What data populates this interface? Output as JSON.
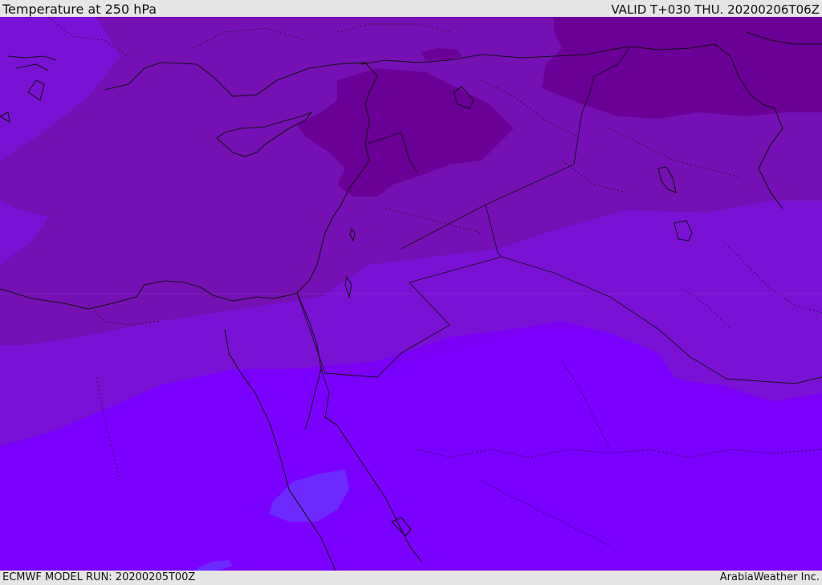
{
  "header": {
    "title": "Temperature at 250 hPa",
    "valid": "VALID T+030 THU. 20200206T06Z"
  },
  "footer": {
    "model_run": "ECMWF MODEL RUN: 20200205T00Z",
    "brand": "ArabiaWeather Inc."
  },
  "map": {
    "colors": {
      "coldest": "#6a0096",
      "cold": "#7410b4",
      "cool": "#7a12d6",
      "mild": "#7c00f6",
      "warm": "#7a00ff",
      "warm_spot": "#6c2aff",
      "coast": "#111111"
    }
  }
}
